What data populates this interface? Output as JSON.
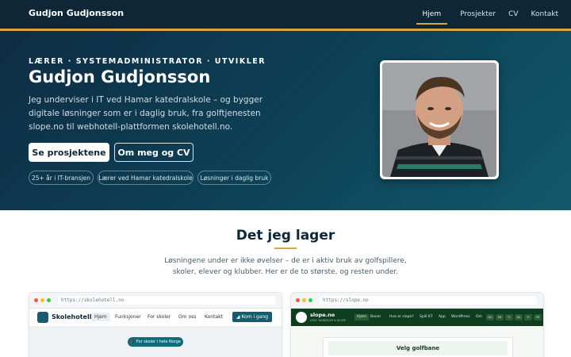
{
  "nav": {
    "brand": "Gudjon Gudjonsson",
    "links": [
      {
        "label": "Hjem",
        "active": true
      },
      {
        "label": "Prosjekter",
        "active": false
      },
      {
        "label": "CV",
        "active": false
      },
      {
        "label": "Kontakt",
        "active": false
      }
    ]
  },
  "hero": {
    "eyebrow": "LÆRER · SYSTEMADMINISTRATOR · UTVIKLER",
    "title": "Gudjon Gudjonsson",
    "description": "Jeg underviser i IT ved Hamar katedralskole – og bygger digitale løsninger som er i daglig bruk, fra golftjenesten slope.no til webhotell-plattformen skolehotell.no.",
    "primary_button": "Se prosjektene",
    "secondary_button": "Om meg og CV",
    "chips": [
      "25+ år i IT-bransjen",
      "Lærer ved Hamar katedralskole",
      "Løsninger i daglig bruk"
    ]
  },
  "section": {
    "title": "Det jeg lager",
    "description": "Løsningene under er ikke øvelser – de er i aktiv bruk av golfspillere, skoler, elever og klubber. Her er de to største, og resten under."
  },
  "cards": {
    "skolehotell": {
      "url": "https://skolehotell.no",
      "name": "Skolehotell",
      "links": [
        "Hjem",
        "Funksjoner",
        "For skoler",
        "Om oss",
        "Kontakt"
      ],
      "cta": "Kom i gang",
      "pill": "For skoler i hele Norge"
    },
    "slope": {
      "url": "https://slope.no",
      "name": "slope.no",
      "subtitle": "GOLF HANDICAP & SLOPE",
      "links": [
        "Hjem",
        "Baner",
        "Hva er slope?",
        "Spill 67",
        "App",
        "WordPress",
        "Om"
      ],
      "langs": [
        "NO",
        "EN",
        "FI",
        "DA",
        "FI",
        "FR"
      ],
      "box_title": "Velg golfbane"
    }
  },
  "colors": {
    "accent": "#d9a53f",
    "nav_bg": "#0f2637",
    "hero_bg": "#0d4257"
  }
}
